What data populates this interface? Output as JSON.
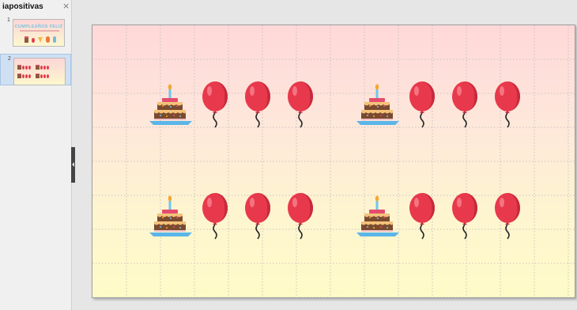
{
  "panel": {
    "title": "iapositivas",
    "close_glyph": "×",
    "thumbnails": [
      {
        "number": "1",
        "title": "CUMPLEAÑOS FELIZ"
      },
      {
        "number": "2"
      }
    ]
  },
  "colors": {
    "balloon": "#e8394c",
    "balloon_dark": "#c72a3c",
    "cake_base": "#7a4a2e",
    "cake_cream": "#f4c27a",
    "cake_top": "#e44d6d",
    "plate": "#5bb6e8",
    "candle": "#6ec6f0",
    "flame": "#f4a72f"
  },
  "slide": {
    "groups": [
      {
        "cake": "cake-icon",
        "balloons": 3
      },
      {
        "cake": "cake-icon",
        "balloons": 3
      },
      {
        "cake": "cake-icon",
        "balloons": 3
      },
      {
        "cake": "cake-icon",
        "balloons": 3
      }
    ]
  }
}
